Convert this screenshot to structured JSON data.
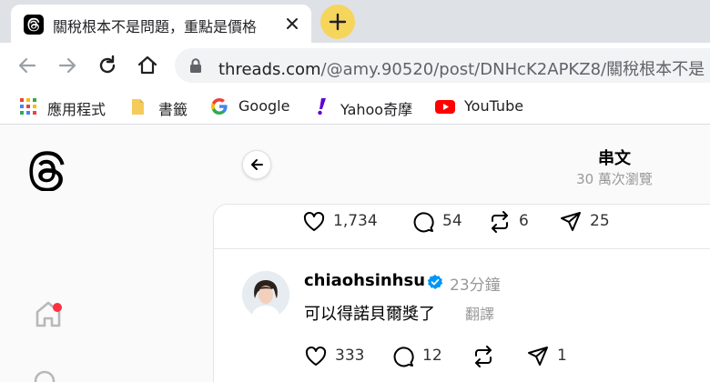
{
  "browser": {
    "tab_title": "關稅根本不是問題，重點是價格",
    "url_domain": "threads.com",
    "url_path": "/@amy.90520/post/DNHcK2APKZ8/關稅根本不是",
    "newtab_color": "#f6d55c"
  },
  "bookmarks": [
    {
      "label": "應用程式",
      "icon": "apps-grid-icon"
    },
    {
      "label": "書籤",
      "icon": "folder-icon"
    },
    {
      "label": "Google",
      "icon": "google-icon"
    },
    {
      "label": "Yahoo奇摩",
      "icon": "yahoo-icon"
    },
    {
      "label": "YouTube",
      "icon": "youtube-icon"
    }
  ],
  "header": {
    "title": "串文",
    "subtitle": "30 萬次瀏覽"
  },
  "post_stats": {
    "likes": "1,734",
    "comments": "54",
    "reposts": "6",
    "shares": "25"
  },
  "reply": {
    "username": "chiaohsinhsu",
    "verified": true,
    "time": "23分鐘",
    "text": "可以得諾貝爾獎了",
    "translate_label": "翻譯",
    "likes": "333",
    "comments": "12",
    "shares": "1"
  },
  "colors": {
    "notification_dot": "#ff3040",
    "verified_badge": "#0095f6"
  }
}
